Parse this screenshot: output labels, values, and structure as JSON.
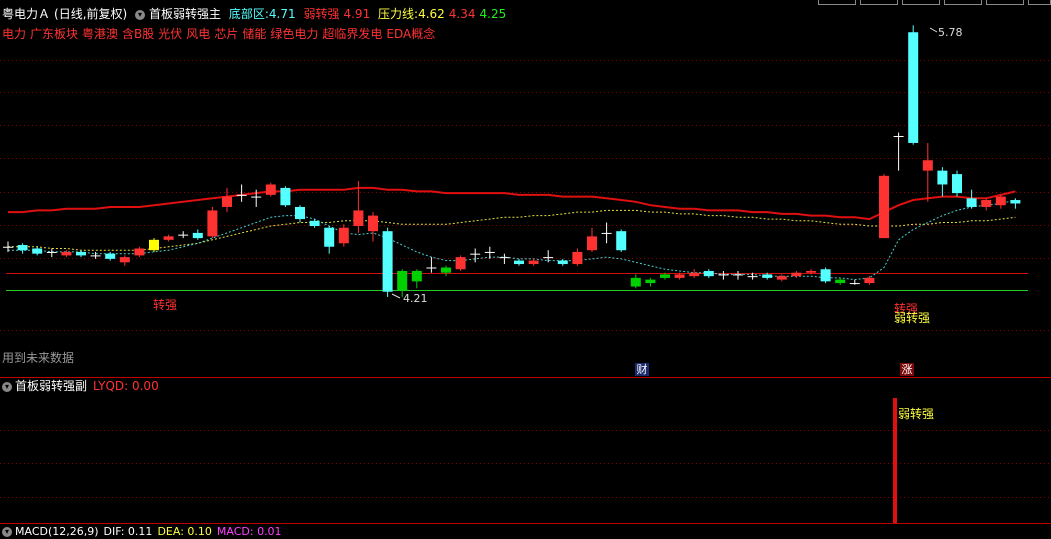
{
  "header": {
    "stock_name": "粤电力Ａ",
    "period": "(日线,前复权)",
    "indicator": "首板弱转强主",
    "bottom_label": "底部区:",
    "bottom_value": "4.71",
    "weak_strong_label": "弱转强",
    "weak_strong_value": "4.91",
    "pressure_label": "压力线:",
    "pressure_value_1": "4.62",
    "pressure_value_2": "4.34",
    "pressure_value_3": "4.25"
  },
  "concepts": [
    "电力",
    "广东板块",
    "粤港澳",
    "含B股",
    "光伏",
    "风电",
    "芯片",
    "储能",
    "绿色电力",
    "超临界发电",
    "EDA概念"
  ],
  "annotations": {
    "high_price": "5.78",
    "low_price": "4.21",
    "signal_left": "转强",
    "signal_right_top": "转强",
    "signal_right": "弱转强",
    "future_data": "用到未来数据",
    "badge_finance": "财",
    "badge_rise": "涨"
  },
  "sub_panel": {
    "title": "首板弱转强副",
    "value_label": "LYQD: 0.00",
    "signal_label": "弱转强"
  },
  "macd": {
    "title": "MACD(12,26,9)",
    "dif": "DIF: 0.11",
    "dea": "DEA: 0.10",
    "macd": "MACD: 0.01"
  },
  "colors": {
    "up": "#ff3232",
    "down": "#54ffff",
    "green_candle": "#00d000",
    "yellow_candle": "#ffff00",
    "red_line": "#e01010",
    "green_line": "#22cc22",
    "yellow_dash": "#e8e040",
    "cyan_dash": "#4ad0d0",
    "grid": "#8a0000"
  },
  "candles": [
    {
      "c": "doji",
      "o": 4.5,
      "h": 4.53,
      "l": 4.47,
      "cl": 4.5
    },
    {
      "c": "down",
      "o": 4.51,
      "h": 4.52,
      "l": 4.46,
      "cl": 4.48
    },
    {
      "c": "down",
      "o": 4.49,
      "h": 4.5,
      "l": 4.45,
      "cl": 4.46
    },
    {
      "c": "doji",
      "o": 4.47,
      "h": 4.49,
      "l": 4.44,
      "cl": 4.47
    },
    {
      "c": "up",
      "o": 4.45,
      "h": 4.48,
      "l": 4.44,
      "cl": 4.47
    },
    {
      "c": "down",
      "o": 4.47,
      "h": 4.48,
      "l": 4.44,
      "cl": 4.45
    },
    {
      "c": "doji",
      "o": 4.45,
      "h": 4.47,
      "l": 4.43,
      "cl": 4.45
    },
    {
      "c": "down",
      "o": 4.46,
      "h": 4.47,
      "l": 4.42,
      "cl": 4.43
    },
    {
      "c": "up",
      "o": 4.41,
      "h": 4.45,
      "l": 4.39,
      "cl": 4.44
    },
    {
      "c": "up",
      "o": 4.45,
      "h": 4.5,
      "l": 4.44,
      "cl": 4.49
    },
    {
      "c": "yellow",
      "o": 4.48,
      "h": 4.55,
      "l": 4.47,
      "cl": 4.54
    },
    {
      "c": "up",
      "o": 4.54,
      "h": 4.57,
      "l": 4.53,
      "cl": 4.56
    },
    {
      "c": "doji",
      "o": 4.57,
      "h": 4.59,
      "l": 4.55,
      "cl": 4.57
    },
    {
      "c": "down",
      "o": 4.58,
      "h": 4.6,
      "l": 4.54,
      "cl": 4.55
    },
    {
      "c": "up",
      "o": 4.56,
      "h": 4.73,
      "l": 4.55,
      "cl": 4.71
    },
    {
      "c": "up",
      "o": 4.73,
      "h": 4.84,
      "l": 4.7,
      "cl": 4.79
    },
    {
      "c": "doji",
      "o": 4.8,
      "h": 4.86,
      "l": 4.76,
      "cl": 4.8
    },
    {
      "c": "doji",
      "o": 4.79,
      "h": 4.83,
      "l": 4.73,
      "cl": 4.79
    },
    {
      "c": "up",
      "o": 4.8,
      "h": 4.87,
      "l": 4.79,
      "cl": 4.86
    },
    {
      "c": "down",
      "o": 4.84,
      "h": 4.85,
      "l": 4.73,
      "cl": 4.74
    },
    {
      "c": "down",
      "o": 4.73,
      "h": 4.74,
      "l": 4.64,
      "cl": 4.66
    },
    {
      "c": "down",
      "o": 4.65,
      "h": 4.66,
      "l": 4.61,
      "cl": 4.62
    },
    {
      "c": "down",
      "o": 4.61,
      "h": 4.62,
      "l": 4.46,
      "cl": 4.5
    },
    {
      "c": "up",
      "o": 4.52,
      "h": 4.63,
      "l": 4.5,
      "cl": 4.61
    },
    {
      "c": "up",
      "o": 4.62,
      "h": 4.88,
      "l": 4.58,
      "cl": 4.71
    },
    {
      "c": "up",
      "o": 4.59,
      "h": 4.7,
      "l": 4.53,
      "cl": 4.68
    },
    {
      "c": "down",
      "o": 4.59,
      "h": 4.61,
      "l": 4.21,
      "cl": 4.24
    },
    {
      "c": "green",
      "o": 4.36,
      "h": 4.37,
      "l": 4.21,
      "cl": 4.25
    },
    {
      "c": "green",
      "o": 4.36,
      "h": 4.37,
      "l": 4.26,
      "cl": 4.3
    },
    {
      "c": "doji",
      "o": 4.38,
      "h": 4.44,
      "l": 4.35,
      "cl": 4.38
    },
    {
      "c": "green",
      "o": 4.38,
      "h": 4.39,
      "l": 4.33,
      "cl": 4.35
    },
    {
      "c": "up",
      "o": 4.37,
      "h": 4.45,
      "l": 4.36,
      "cl": 4.44
    },
    {
      "c": "doji",
      "o": 4.46,
      "h": 4.49,
      "l": 4.41,
      "cl": 4.46
    },
    {
      "c": "doji",
      "o": 4.47,
      "h": 4.5,
      "l": 4.43,
      "cl": 4.47
    },
    {
      "c": "doji",
      "o": 4.44,
      "h": 4.46,
      "l": 4.4,
      "cl": 4.44
    },
    {
      "c": "down",
      "o": 4.42,
      "h": 4.43,
      "l": 4.39,
      "cl": 4.4
    },
    {
      "c": "up",
      "o": 4.4,
      "h": 4.43,
      "l": 4.39,
      "cl": 4.42
    },
    {
      "c": "doji",
      "o": 4.44,
      "h": 4.48,
      "l": 4.41,
      "cl": 4.44
    },
    {
      "c": "down",
      "o": 4.42,
      "h": 4.43,
      "l": 4.39,
      "cl": 4.4
    },
    {
      "c": "up",
      "o": 4.4,
      "h": 4.49,
      "l": 4.39,
      "cl": 4.47
    },
    {
      "c": "up",
      "o": 4.48,
      "h": 4.61,
      "l": 4.47,
      "cl": 4.56
    },
    {
      "c": "doji",
      "o": 4.58,
      "h": 4.64,
      "l": 4.52,
      "cl": 4.58
    },
    {
      "c": "down",
      "o": 4.59,
      "h": 4.6,
      "l": 4.47,
      "cl": 4.48
    },
    {
      "c": "green",
      "o": 4.32,
      "h": 4.34,
      "l": 4.26,
      "cl": 4.27
    },
    {
      "c": "green",
      "o": 4.29,
      "h": 4.32,
      "l": 4.27,
      "cl": 4.31
    },
    {
      "c": "green",
      "o": 4.34,
      "h": 4.35,
      "l": 4.31,
      "cl": 4.32
    },
    {
      "c": "up",
      "o": 4.32,
      "h": 4.35,
      "l": 4.31,
      "cl": 4.34
    },
    {
      "c": "up",
      "o": 4.33,
      "h": 4.37,
      "l": 4.32,
      "cl": 4.35
    },
    {
      "c": "down",
      "o": 4.36,
      "h": 4.37,
      "l": 4.32,
      "cl": 4.33
    },
    {
      "c": "doji",
      "o": 4.34,
      "h": 4.36,
      "l": 4.31,
      "cl": 4.34
    },
    {
      "c": "doji",
      "o": 4.34,
      "h": 4.36,
      "l": 4.31,
      "cl": 4.34
    },
    {
      "c": "doji",
      "o": 4.33,
      "h": 4.35,
      "l": 4.31,
      "cl": 4.33
    },
    {
      "c": "down",
      "o": 4.34,
      "h": 4.35,
      "l": 4.31,
      "cl": 4.32
    },
    {
      "c": "up",
      "o": 4.31,
      "h": 4.34,
      "l": 4.3,
      "cl": 4.33
    },
    {
      "c": "up",
      "o": 4.33,
      "h": 4.36,
      "l": 4.32,
      "cl": 4.35
    },
    {
      "c": "up",
      "o": 4.35,
      "h": 4.37,
      "l": 4.34,
      "cl": 4.36
    },
    {
      "c": "down",
      "o": 4.37,
      "h": 4.38,
      "l": 4.29,
      "cl": 4.3
    },
    {
      "c": "green",
      "o": 4.31,
      "h": 4.32,
      "l": 4.28,
      "cl": 4.29
    },
    {
      "c": "doji",
      "o": 4.29,
      "h": 4.31,
      "l": 4.28,
      "cl": 4.29
    },
    {
      "c": "up",
      "o": 4.29,
      "h": 4.33,
      "l": 4.28,
      "cl": 4.32
    },
    {
      "c": "up",
      "o": 4.55,
      "h": 4.92,
      "l": 4.55,
      "cl": 4.91
    },
    {
      "c": "doji",
      "o": 5.14,
      "h": 5.16,
      "l": 4.94,
      "cl": 5.14
    },
    {
      "c": "down",
      "o": 5.74,
      "h": 5.78,
      "l": 5.09,
      "cl": 5.1
    },
    {
      "c": "up",
      "o": 4.94,
      "h": 5.1,
      "l": 4.76,
      "cl": 5.0
    },
    {
      "c": "down",
      "o": 4.94,
      "h": 4.96,
      "l": 4.79,
      "cl": 4.86
    },
    {
      "c": "down",
      "o": 4.92,
      "h": 4.94,
      "l": 4.79,
      "cl": 4.81
    },
    {
      "c": "down",
      "o": 4.78,
      "h": 4.83,
      "l": 4.72,
      "cl": 4.73
    },
    {
      "c": "up",
      "o": 4.73,
      "h": 4.78,
      "l": 4.71,
      "cl": 4.77
    },
    {
      "c": "up",
      "o": 4.74,
      "h": 4.8,
      "l": 4.72,
      "cl": 4.79
    },
    {
      "c": "down",
      "o": 4.77,
      "h": 4.78,
      "l": 4.72,
      "cl": 4.75
    }
  ],
  "ma_red": [
    4.7,
    4.7,
    4.71,
    4.71,
    4.72,
    4.72,
    4.72,
    4.73,
    4.73,
    4.73,
    4.74,
    4.75,
    4.76,
    4.77,
    4.78,
    4.79,
    4.8,
    4.81,
    4.82,
    4.82,
    4.83,
    4.83,
    4.83,
    4.83,
    4.84,
    4.84,
    4.83,
    4.83,
    4.82,
    4.82,
    4.81,
    4.81,
    4.81,
    4.81,
    4.81,
    4.8,
    4.8,
    4.8,
    4.79,
    4.79,
    4.79,
    4.78,
    4.77,
    4.76,
    4.74,
    4.73,
    4.72,
    4.72,
    4.71,
    4.71,
    4.71,
    4.7,
    4.7,
    4.69,
    4.69,
    4.68,
    4.68,
    4.67,
    4.67,
    4.66,
    4.7,
    4.74,
    4.77,
    4.78,
    4.79,
    4.79,
    4.78,
    4.78,
    4.8,
    4.82
  ],
  "ma_yellow": [
    4.5,
    4.5,
    4.5,
    4.49,
    4.49,
    4.48,
    4.48,
    4.48,
    4.48,
    4.48,
    4.49,
    4.5,
    4.51,
    4.52,
    4.54,
    4.56,
    4.58,
    4.6,
    4.62,
    4.63,
    4.64,
    4.64,
    4.64,
    4.65,
    4.65,
    4.65,
    4.64,
    4.63,
    4.63,
    4.63,
    4.63,
    4.64,
    4.65,
    4.66,
    4.67,
    4.67,
    4.68,
    4.68,
    4.69,
    4.7,
    4.7,
    4.71,
    4.71,
    4.71,
    4.7,
    4.7,
    4.69,
    4.69,
    4.68,
    4.68,
    4.67,
    4.67,
    4.66,
    4.66,
    4.65,
    4.65,
    4.64,
    4.63,
    4.63,
    4.62,
    4.62,
    4.62,
    4.63,
    4.63,
    4.64,
    4.64,
    4.65,
    4.65,
    4.66,
    4.67
  ],
  "ma_cyan": [
    4.48,
    4.48,
    4.48,
    4.47,
    4.47,
    4.47,
    4.46,
    4.46,
    4.46,
    4.46,
    4.47,
    4.48,
    4.5,
    4.52,
    4.55,
    4.58,
    4.61,
    4.64,
    4.67,
    4.68,
    4.68,
    4.66,
    4.62,
    4.58,
    4.57,
    4.58,
    4.55,
    4.51,
    4.47,
    4.44,
    4.42,
    4.42,
    4.43,
    4.44,
    4.44,
    4.43,
    4.43,
    4.42,
    4.42,
    4.42,
    4.43,
    4.44,
    4.43,
    4.41,
    4.39,
    4.37,
    4.36,
    4.35,
    4.35,
    4.34,
    4.34,
    4.34,
    4.33,
    4.33,
    4.33,
    4.33,
    4.32,
    4.32,
    4.31,
    4.32,
    4.38,
    4.54,
    4.6,
    4.64,
    4.68,
    4.71,
    4.73,
    4.74,
    4.75,
    4.77
  ]
}
